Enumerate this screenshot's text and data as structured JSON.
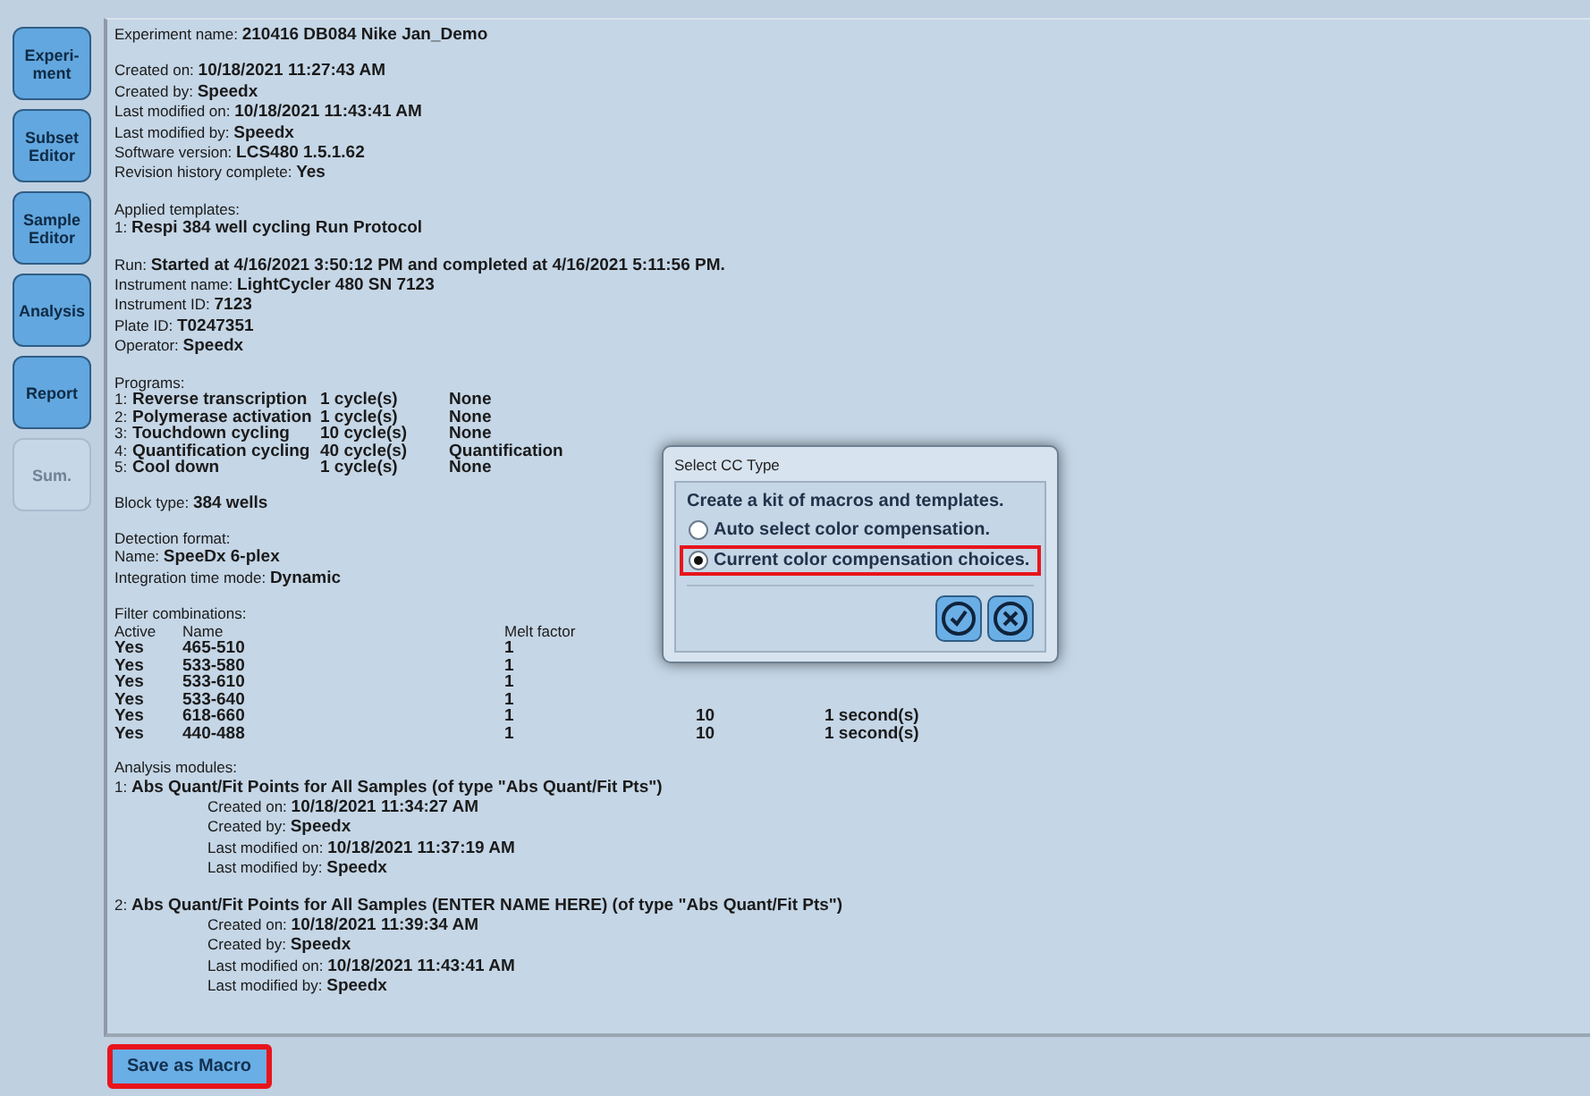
{
  "sidebar": {
    "items": [
      {
        "label": "Experi-\nment",
        "disabled": false
      },
      {
        "label": "Subset\nEditor",
        "disabled": false
      },
      {
        "label": "Sample\nEditor",
        "disabled": false
      },
      {
        "label": "Analysis",
        "disabled": false
      },
      {
        "label": "Report",
        "disabled": false
      },
      {
        "label": "Sum.",
        "disabled": true
      }
    ]
  },
  "report": {
    "sections": [
      {
        "kind": "lines",
        "lines": [
          "Experiment name: **210416 DB084 Nike Jan_Demo**"
        ]
      },
      {
        "kind": "lines",
        "lines": [
          "Created on: **10/18/2021 11:27:43 AM**",
          "Created by: **Speedx**",
          "Last modified on: **10/18/2021 11:43:41 AM**",
          "Last modified by: **Speedx**",
          "Software version: **LCS480 1.5.1.62**",
          "Revision history complete: **Yes**"
        ]
      },
      {
        "kind": "lines",
        "lines": [
          "Applied templates:",
          "1: **Respi 384 well cycling Run Protocol**"
        ]
      },
      {
        "kind": "lines",
        "lines": [
          "Run: **Started at 4/16/2021 3:50:12 PM and completed at 4/16/2021 5:11:56 PM.**",
          "Instrument name: **LightCycler 480 SN 7123**",
          "Instrument ID: **7123**",
          "Plate ID: **T0247351**",
          "Operator: **Speedx**"
        ]
      },
      {
        "kind": "programs",
        "heading": "Programs:",
        "rows": [
          {
            "number": "1:",
            "name": "Reverse transcription",
            "cycles": "1 cycle(s)",
            "mode": "None"
          },
          {
            "number": "2:",
            "name": "Polymerase activation",
            "cycles": "1 cycle(s)",
            "mode": "None"
          },
          {
            "number": "3:",
            "name": "Touchdown cycling",
            "cycles": "10 cycle(s)",
            "mode": "None"
          },
          {
            "number": "4:",
            "name": "Quantification cycling",
            "cycles": "40 cycle(s)",
            "mode": "Quantification"
          },
          {
            "number": "5:",
            "name": "Cool down",
            "cycles": "1 cycle(s)",
            "mode": "None"
          }
        ]
      },
      {
        "kind": "lines",
        "lines": [
          "Block type: **384 wells**"
        ]
      },
      {
        "kind": "lines",
        "lines": [
          "Detection format:",
          "Name: **SpeeDx 6-plex**",
          "Integration time mode: **Dynamic**"
        ]
      },
      {
        "kind": "filters",
        "heading": "Filter combinations:",
        "columns": [
          "Active",
          "Name",
          "Melt factor"
        ],
        "rows": [
          {
            "active": "Yes",
            "name": "465-510",
            "melt_factor": "1"
          },
          {
            "active": "Yes",
            "name": "533-580",
            "melt_factor": "1"
          },
          {
            "active": "Yes",
            "name": "533-610",
            "melt_factor": "1"
          },
          {
            "active": "Yes",
            "name": "533-640",
            "melt_factor": "1"
          },
          {
            "active": "Yes",
            "name": "618-660",
            "melt_factor": "1",
            "column_4": "10",
            "column_5": "1 second(s)"
          },
          {
            "active": "Yes",
            "name": "440-488",
            "melt_factor": "1",
            "column_4": "10",
            "column_5": "1 second(s)"
          }
        ]
      },
      {
        "kind": "modules",
        "heading": "Analysis modules:",
        "modules": [
          {
            "title": "1: **Abs Quant/Fit Points for All Samples (of type \"Abs Quant/Fit Pts\")**",
            "details": [
              "Created on: **10/18/2021 11:34:27 AM**",
              "Created by: **Speedx**",
              "Last modified on: **10/18/2021 11:37:19 AM**",
              "Last modified by: **Speedx**"
            ]
          },
          {
            "title": "2: **Abs Quant/Fit Points for All Samples (ENTER NAME HERE) (of type \"Abs Quant/Fit Pts\")**",
            "details": [
              "Created on: **10/18/2021 11:39:34 AM**",
              "Created by: **Speedx**",
              "Last modified on: **10/18/2021 11:43:41 AM**",
              "Last modified by: **Speedx**"
            ]
          }
        ]
      }
    ]
  },
  "dialog": {
    "title": "Select CC Type",
    "prompt": "Create a kit of macros and templates.",
    "options": [
      {
        "label": "Auto select color compensation.",
        "selected": false,
        "highlighted": false
      },
      {
        "label": "Current color compensation choices.",
        "selected": true,
        "highlighted": true
      }
    ]
  },
  "save_button": {
    "label": "Save as Macro",
    "highlighted": true
  }
}
